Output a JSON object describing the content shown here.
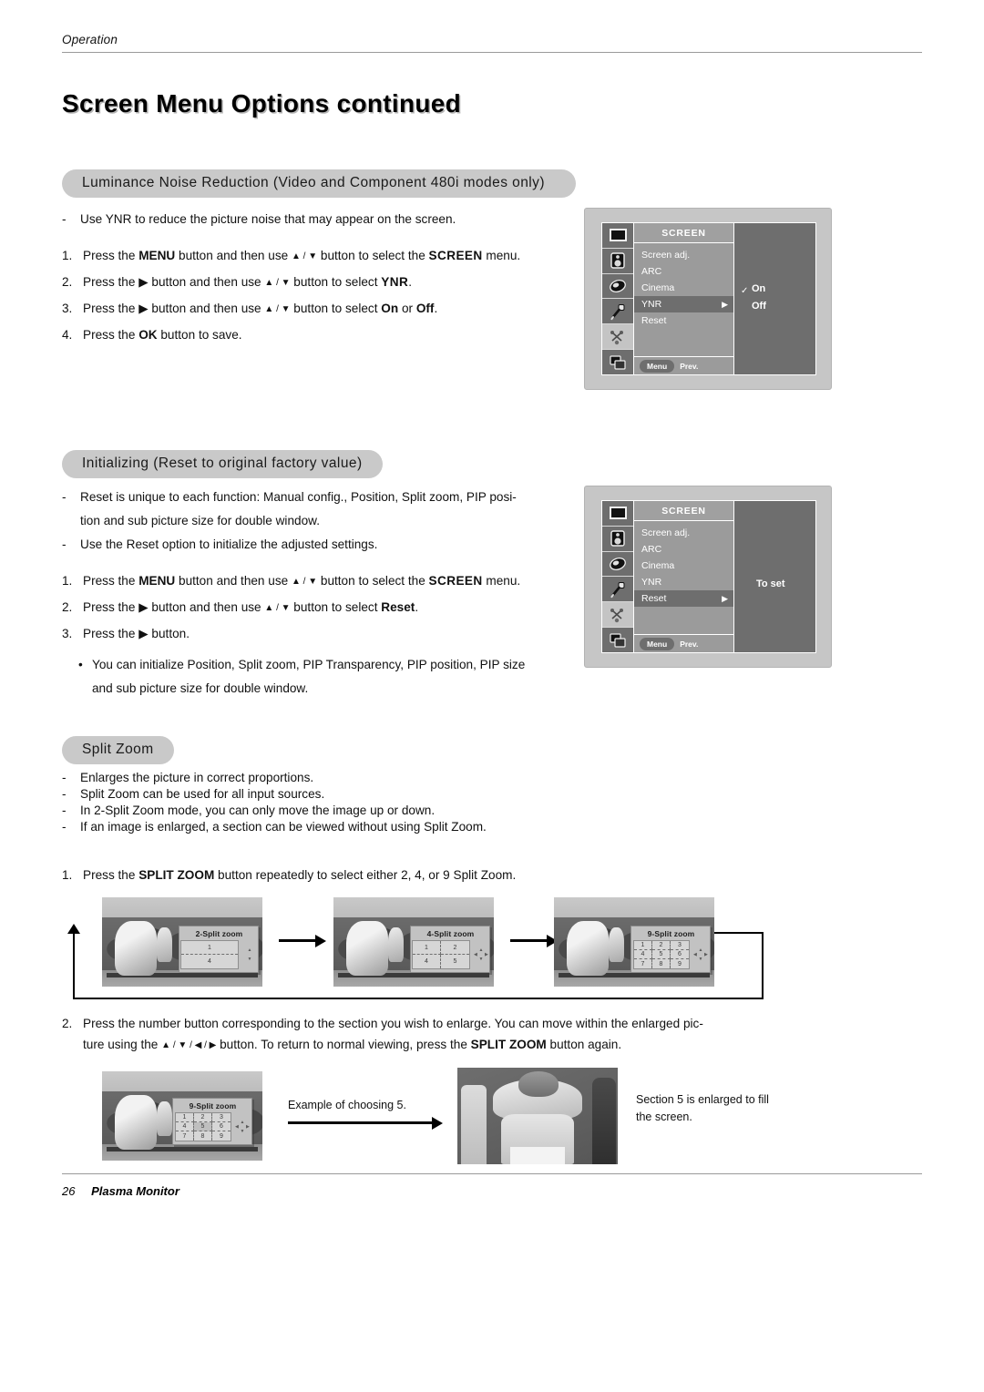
{
  "header": {
    "running_head": "Operation",
    "title": "Screen Menu Options continued"
  },
  "sections": [
    {
      "id": "ynr",
      "heading": "Luminance Noise Reduction (Video  and Component 480i modes only)",
      "dashes": [
        "Use YNR to reduce the picture noise that may appear on the screen."
      ],
      "steps": [
        {
          "n": "1.",
          "pre": "Press the ",
          "b1": "MENU",
          "mid": " button and then use ",
          "arrows": "▲ / ▼",
          "mid2": " button to select the ",
          "b2": "SCREEN",
          "post": " menu."
        },
        {
          "n": "2.",
          "pre": "Press the ▶ button and then use ",
          "arrows": "▲ / ▼",
          "mid2": " button to select ",
          "b2": "YNR",
          "post": "."
        },
        {
          "n": "3.",
          "pre": "Press the ▶ button and then use ",
          "arrows": "▲ / ▼",
          "mid2": " button to select ",
          "b2": "On",
          "mid3": " or ",
          "b3": "Off",
          "post": "."
        },
        {
          "n": "4.",
          "pre": "Press the ",
          "b1": "OK",
          "post": " button to save."
        }
      ]
    },
    {
      "id": "reset",
      "heading": "Initializing (Reset to original factory value)",
      "dashes": [
        "Reset is unique to each function: Manual config., Position, Split zoom, PIP posi-",
        "tion and sub picture size for double window.",
        "Use the Reset option to initialize the adjusted settings."
      ],
      "steps": [
        {
          "n": "1.",
          "pre": "Press the ",
          "b1": "MENU",
          "mid": " button and then use ",
          "arrows": "▲ / ▼",
          "mid2": " button to select the ",
          "b2": "SCREEN",
          "post": " menu."
        },
        {
          "n": "2.",
          "pre": "Press the ▶ button and then use ",
          "arrows": "▲ / ▼",
          "mid2": " button to select ",
          "b2": "Reset",
          "post": "."
        },
        {
          "n": "3.",
          "pre": "Press the ▶ button.",
          "post": ""
        }
      ],
      "bullets": [
        "You can initialize Position, Split zoom, PIP Transparency, PIP position, PIP size",
        "and sub picture size for double window."
      ]
    },
    {
      "id": "splitzoom",
      "heading": "Split Zoom",
      "dashes": [
        "Enlarges the picture in correct proportions.",
        "Split Zoom can be used for all input sources.",
        "In 2-Split Zoom mode, you can only move the image up or down.",
        "If an image is enlarged, a section can be viewed without using Split Zoom."
      ],
      "step1": {
        "n": "1.",
        "pre": "Press the ",
        "b1": "SPLIT ZOOM",
        "post": " button repeatedly to select either 2, 4, or 9 Split Zoom."
      },
      "step2_line1_pre": "Press the number button corresponding to the section you wish to enlarge. You can move within the enlarged pic-",
      "step2_n": "2.",
      "step2_line2_pre": "ture using the ",
      "step2_arrows": "▲ / ▼ / ◀ / ▶",
      "step2_line2_mid": " button. To return to normal viewing, press the ",
      "step2_bold": "SPLIT ZOOM",
      "step2_line2_post": " button again."
    }
  ],
  "osd": {
    "menu_title": "SCREEN",
    "sidebar_icons": [
      "picture-icon",
      "sound-icon",
      "timer-icon",
      "special-icon",
      "screen-icon",
      "pip-icon"
    ],
    "footer_button": "Menu",
    "footer_label": "Prev.",
    "panel_ynr": {
      "items": [
        "Screen adj.",
        "ARC",
        "Cinema",
        "YNR",
        "Reset"
      ],
      "selected": "YNR",
      "options": [
        "On",
        "Off"
      ],
      "checked": "On"
    },
    "panel_reset": {
      "items": [
        "Screen adj.",
        "ARC",
        "Cinema",
        "YNR",
        "Reset"
      ],
      "selected": "Reset",
      "value_label": "To set"
    }
  },
  "splitzoom_figures": [
    {
      "title": "2-Split zoom",
      "cols": 1,
      "rows": 2,
      "cells": [
        "1",
        "4"
      ]
    },
    {
      "title": "4-Split zoom",
      "cols": 2,
      "rows": 2,
      "cells": [
        "1",
        "2",
        "4",
        "5"
      ]
    },
    {
      "title": "9-Split zoom",
      "cols": 3,
      "rows": 3,
      "cells": [
        "1",
        "2",
        "3",
        "4",
        "5",
        "6",
        "7",
        "8",
        "9"
      ]
    }
  ],
  "example": {
    "figure": {
      "title": "9-Split zoom",
      "cols": 3,
      "rows": 3,
      "cells": [
        "1",
        "2",
        "3",
        "4",
        "5",
        "6",
        "7",
        "8",
        "9"
      ]
    },
    "arrow_caption": "Example of choosing 5.",
    "result_caption_line1": "Section 5 is enlarged to fill",
    "result_caption_line2": "the screen."
  },
  "footer": {
    "page_number": "26",
    "product": "Plasma Monitor"
  },
  "colors": {
    "pill_bg": "#c9c9c9",
    "rule": "#9a9a9a",
    "osd_bg": "#9b9b9b",
    "osd_dark": "#6e6e6e",
    "text": "#111111"
  }
}
